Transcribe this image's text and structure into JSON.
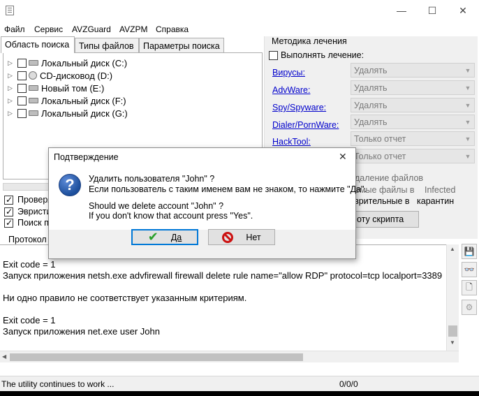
{
  "window": {
    "minimize": "—",
    "maximize": "☐",
    "close": "✕"
  },
  "menu": [
    "Файл",
    "Сервис",
    "AVZGuard",
    "AVZPM",
    "Справка"
  ],
  "left_tabs": [
    "Область поиска",
    "Типы файлов",
    "Параметры поиска"
  ],
  "drives": [
    {
      "label": "Локальный диск (C:)",
      "type": "hdd"
    },
    {
      "label": "CD-дисковод (D:)",
      "type": "cd"
    },
    {
      "label": "Новый том (E:)",
      "type": "hdd"
    },
    {
      "label": "Локальный диск  (F:)",
      "type": "hdd"
    },
    {
      "label": "Локальный диск (G:)",
      "type": "hdd"
    }
  ],
  "options": [
    {
      "label": "Проверя",
      "checked": true
    },
    {
      "label": "Эвристи",
      "checked": true
    },
    {
      "label": "Поиск по",
      "checked": true
    }
  ],
  "treatment": {
    "group_title": "Методика лечения",
    "perform_label": "Выполнять лечение:",
    "rows": [
      {
        "label": "Вирусы:",
        "value": "Удалять"
      },
      {
        "label": "AdvWare:",
        "value": "Удалять"
      },
      {
        "label": "Spy/Spyware:",
        "value": "Удалять"
      },
      {
        "label": "Dialer/PornWare:",
        "value": "Удалять"
      },
      {
        "label": "HackTool:",
        "value": "Только отчет"
      },
      {
        "label": "",
        "value": "Только отчет"
      }
    ],
    "partial_line1": "даление файлов",
    "partial_line2a": "емые файлы в",
    "partial_line2b": "Infected",
    "partial_line3a": "зрительные в",
    "partial_line3b": "карантин",
    "script_button": "оту скрипта"
  },
  "protocol_tab": "Протокол",
  "log_lines": [
    "Exit code = 1",
    "Запуск приложения netsh.exe advfirewall firewall delete rule name=\"allow RDP\" protocol=tcp localport=3389",
    "",
    "Ни одно правило не соответствует указанным критериям.",
    "",
    "Exit code = 1",
    "Запуск приложения net.exe user John"
  ],
  "status": {
    "message": "The utility continues to work ...",
    "counter": "0/0/0"
  },
  "dialog": {
    "title": "Подтверждение",
    "close": "✕",
    "line1": "Удалить пользователя \"John\" ?",
    "line2": "Если пользователь с таким именем вам не знаком, то нажмите \"Да\".",
    "line3": "Should we delete account \"John\" ?",
    "line4": "If you don't know that account press \"Yes\".",
    "yes": "Да",
    "no": "Нет",
    "icon": "question-icon"
  },
  "colors": {
    "link": "#0000cc",
    "dialog_accent": "#0078d7",
    "yes_check": "#2aa02a",
    "no_icon": "#cc1111"
  }
}
